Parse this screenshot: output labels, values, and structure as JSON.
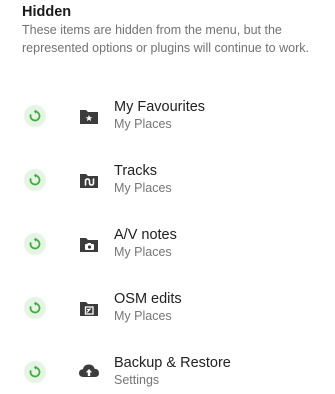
{
  "section": {
    "title": "Hidden",
    "description": "These items are hidden from the menu, but the represented options or plugins will continue to work."
  },
  "colors": {
    "restore_bg": "#e6f4e6",
    "restore_fg": "#3db03d",
    "icon_dark": "#3c3c3c"
  },
  "items": [
    {
      "name": "My Favourites",
      "subtitle": "My Places",
      "icon": "folder-star-icon"
    },
    {
      "name": "Tracks",
      "subtitle": "My Places",
      "icon": "folder-route-icon"
    },
    {
      "name": "A/V notes",
      "subtitle": "My Places",
      "icon": "folder-camera-icon"
    },
    {
      "name": "OSM edits",
      "subtitle": "My Places",
      "icon": "folder-osm-icon"
    },
    {
      "name": "Backup & Restore",
      "subtitle": "Settings",
      "icon": "cloud-upload-icon"
    }
  ]
}
